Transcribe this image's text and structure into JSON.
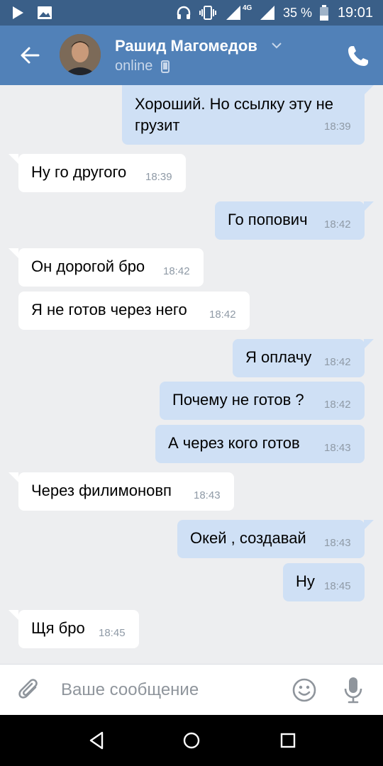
{
  "status_bar": {
    "network": "4G",
    "battery": "35 %",
    "time": "19:01"
  },
  "header": {
    "name": "Рашид Магомедов",
    "status": "online"
  },
  "messages": [
    {
      "dir": "out",
      "text": "Хороший. Но ссылку эту не",
      "text2": "грузит",
      "time": "18:39"
    },
    {
      "dir": "in",
      "text": "Ну го другого",
      "time": "18:39"
    },
    {
      "dir": "out",
      "text": "Го попович",
      "time": "18:42"
    },
    {
      "dir": "in",
      "text": "Он дорогой бро",
      "time": "18:42"
    },
    {
      "dir": "in",
      "text": "Я не готов через него",
      "time": "18:42"
    },
    {
      "dir": "out",
      "text": "Я оплачу",
      "time": "18:42"
    },
    {
      "dir": "out",
      "text": "Почему не готов ?",
      "time": "18:42"
    },
    {
      "dir": "out",
      "text": "А через кого готов",
      "time": "18:43"
    },
    {
      "dir": "in",
      "text": "Через филимоновп",
      "time": "18:43"
    },
    {
      "dir": "out",
      "text": "Окей , создавай",
      "time": "18:43"
    },
    {
      "dir": "out",
      "text": "Ну",
      "time": "18:45"
    },
    {
      "dir": "in",
      "text": "Щя бро",
      "time": "18:45"
    }
  ],
  "composer": {
    "placeholder": "Ваше сообщение"
  },
  "colors": {
    "status_bar": "#3a5f88",
    "header": "#5181b8",
    "chat_bg": "#edeef0",
    "incoming_bubble": "#ffffff",
    "outgoing_bubble": "#cfe0f5",
    "time_text": "#8f9aa6"
  },
  "icons": [
    "play-icon",
    "image-icon",
    "headphones-icon",
    "vibrate-icon",
    "signal-icon",
    "battery-icon",
    "back-arrow-icon",
    "chevron-down-icon",
    "phone-icon",
    "call-icon",
    "paperclip-icon",
    "smile-icon",
    "microphone-icon",
    "nav-back-icon",
    "nav-home-icon",
    "nav-recents-icon"
  ]
}
